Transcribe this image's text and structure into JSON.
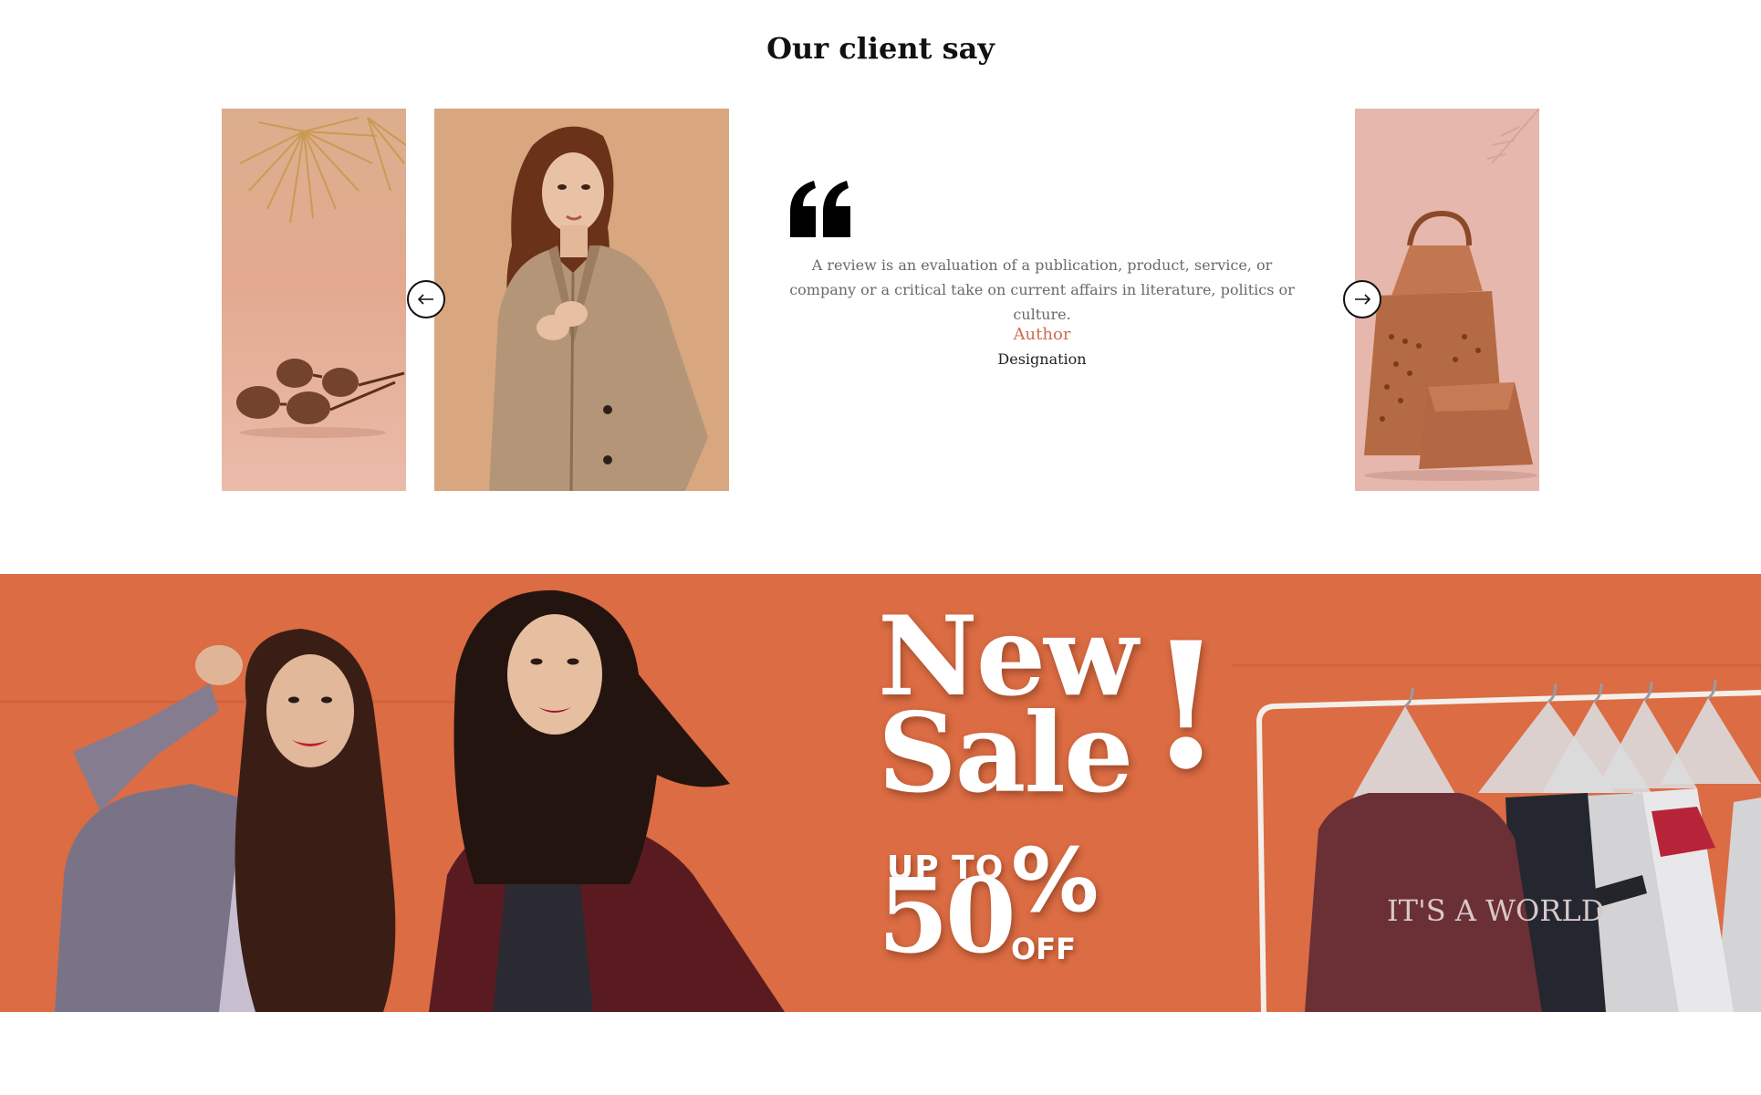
{
  "section": {
    "title": "Our client say"
  },
  "testimonial": {
    "review": "A review is an evaluation of a publication, product, service, or company or a critical take on current affairs in literature, politics or culture.",
    "author": "Author",
    "designation": "Designation",
    "quote_icon": "quote-icon",
    "prev_icon": "arrow-left-icon",
    "next_icon": "arrow-right-icon"
  },
  "slides": [
    {
      "subject": "sunglasses",
      "background": "#e7b5a0"
    },
    {
      "subject": "model in beige blazer",
      "background": "#d8a77f"
    },
    {
      "subject": "leather handbags",
      "background": "#e6b7ac"
    }
  ],
  "banner": {
    "headline_line1": "New",
    "headline_line2": "Sale",
    "exclamation": "!",
    "up_to": "UP TO",
    "percent_value": "50",
    "percent_sign": "%",
    "off": "OFF",
    "background": "#dd6f47",
    "printed_shirt_text": "IT'S A WORLD"
  },
  "colors": {
    "accent": "#cf6d4f",
    "text_muted": "#6a6a6a",
    "heading": "#111111"
  }
}
